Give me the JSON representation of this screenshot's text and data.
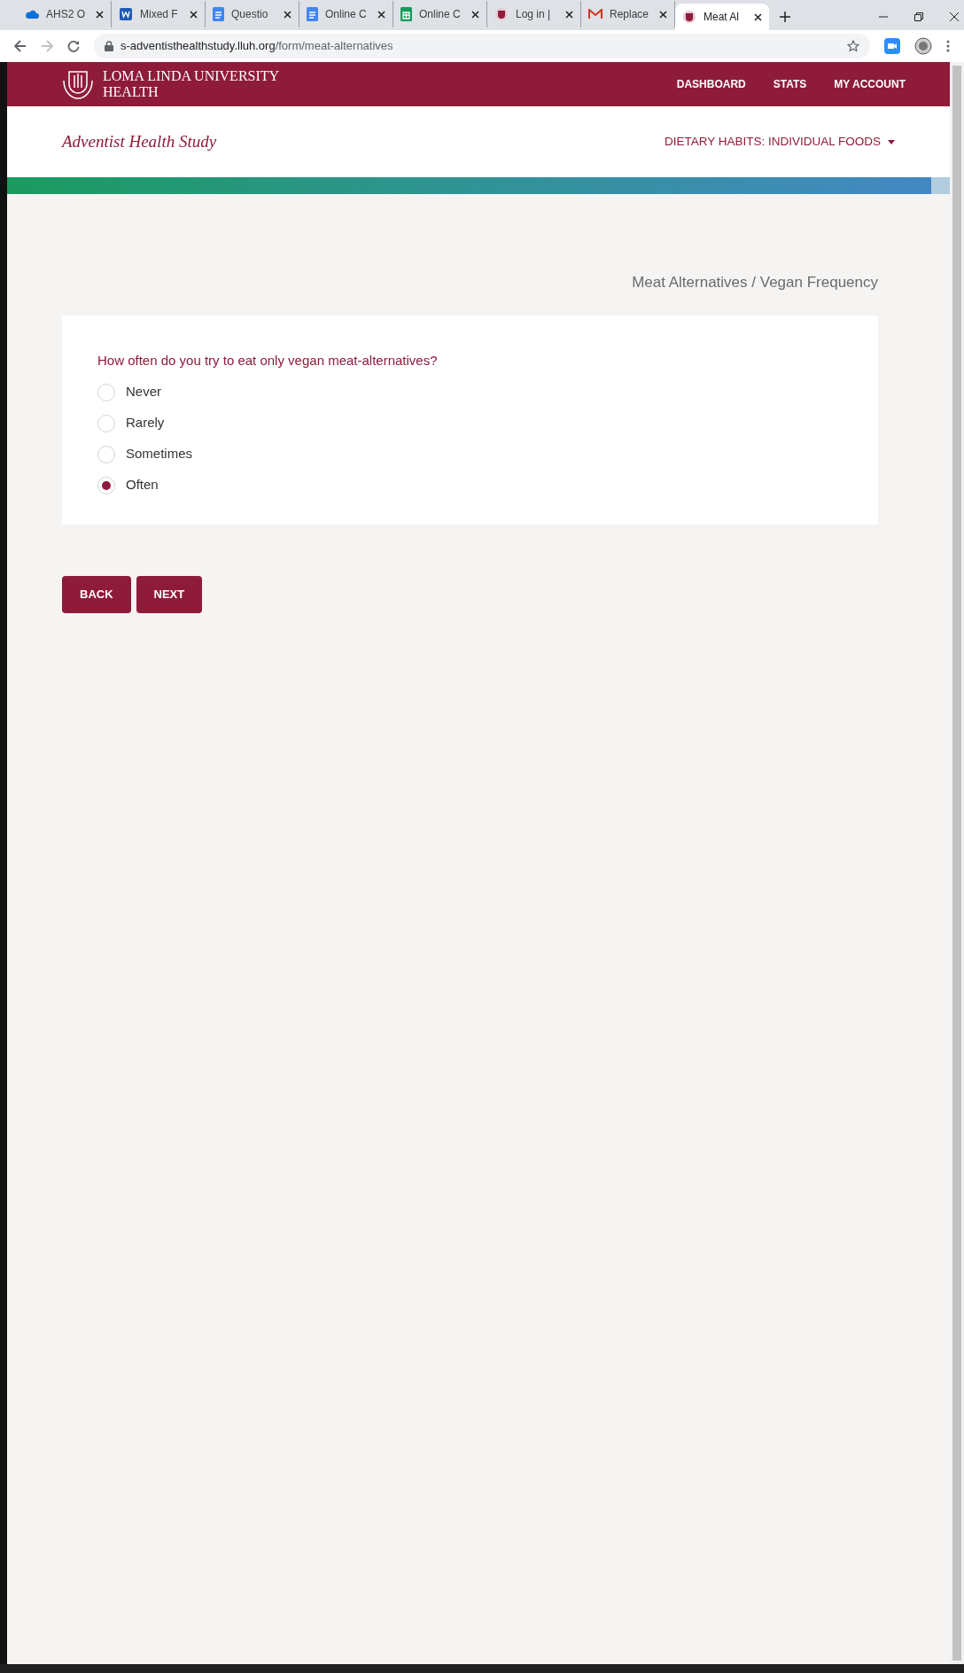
{
  "browser": {
    "tabs": [
      {
        "label": "AHS2 O",
        "kind": "cloud",
        "selected": false
      },
      {
        "label": "Mixed F",
        "kind": "word",
        "selected": false
      },
      {
        "label": "Questio",
        "kind": "doc",
        "selected": false
      },
      {
        "label": "Online C",
        "kind": "doc",
        "selected": false
      },
      {
        "label": "Online C",
        "kind": "sheet",
        "selected": false
      },
      {
        "label": "Log in |",
        "kind": "crest",
        "selected": false
      },
      {
        "label": "Replace",
        "kind": "mail",
        "selected": false
      },
      {
        "label": "Meat Al",
        "kind": "crest",
        "selected": true
      }
    ],
    "url_host": "s-adventisthealthstudy.lluh.org",
    "url_path": "/form/meat-alternatives"
  },
  "header": {
    "logo_line_1": "LOMA LINDA UNIVERSITY",
    "logo_line_2": "HEALTH",
    "nav": [
      "DASHBOARD",
      "STATS",
      "MY ACCOUNT"
    ]
  },
  "subheader": {
    "title": "Adventist Health Study",
    "section_menu": "DIETARY HABITS: INDIVIDUAL FOODS"
  },
  "progress": {
    "level": 0.98
  },
  "breadcrumb": "Meat Alternatives / Vegan Frequency",
  "question": "How often do you try to eat only vegan meat-alternatives?",
  "options": [
    {
      "label": "Never",
      "selected": false
    },
    {
      "label": "Rarely",
      "selected": false
    },
    {
      "label": "Sometimes",
      "selected": false
    },
    {
      "label": "Often",
      "selected": true
    }
  ],
  "buttons": [
    "BACK",
    "NEXT"
  ]
}
